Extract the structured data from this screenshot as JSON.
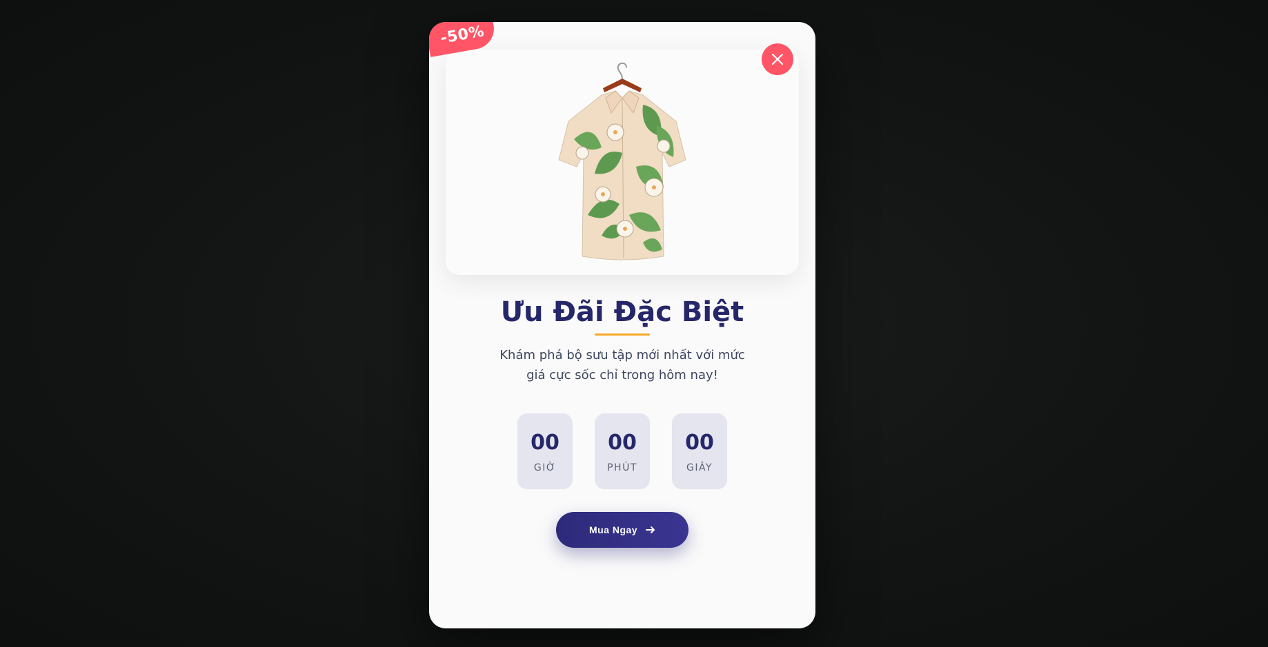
{
  "popup": {
    "discount_badge": "-50%",
    "title": "Ưu Đãi Đặc Biệt",
    "description": "Khám phá bộ sưu tập mới nhất với mức giá cực sốc chỉ trong hôm nay!",
    "countdown": [
      {
        "value": "00",
        "label": "GIỜ"
      },
      {
        "value": "00",
        "label": "PHÚT"
      },
      {
        "value": "00",
        "label": "GIÂY"
      }
    ],
    "cta_label": "Mua Ngay",
    "icons": {
      "close": "close-icon",
      "cta": "arrow-right-icon",
      "product": "shirt-image"
    },
    "colors": {
      "accent": "#ff5566",
      "primary": "#26276a",
      "button": "#2e2a7a",
      "underline": "#f5a623"
    }
  }
}
